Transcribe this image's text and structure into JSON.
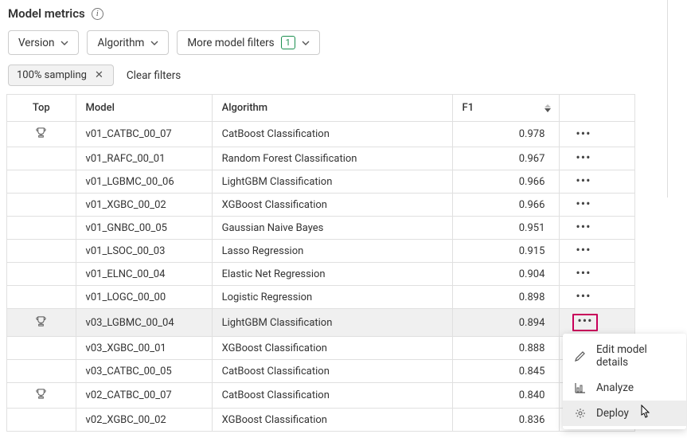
{
  "title": "Model metrics",
  "filters": {
    "version_label": "Version",
    "algorithm_label": "Algorithm",
    "more_label": "More model filters",
    "more_badge": "1"
  },
  "chip": {
    "label": "100% sampling"
  },
  "clear_filters": "Clear filters",
  "columns": {
    "top": "Top",
    "model": "Model",
    "algorithm": "Algorithm",
    "f1": "F1"
  },
  "rows": [
    {
      "top": true,
      "model": "v01_CATBC_00_07",
      "algorithm": "CatBoost Classification",
      "f1": "0.978"
    },
    {
      "top": false,
      "model": "v01_RAFC_00_01",
      "algorithm": "Random Forest Classification",
      "f1": "0.967"
    },
    {
      "top": false,
      "model": "v01_LGBMC_00_06",
      "algorithm": "LightGBM Classification",
      "f1": "0.966"
    },
    {
      "top": false,
      "model": "v01_XGBC_00_02",
      "algorithm": "XGBoost Classification",
      "f1": "0.966"
    },
    {
      "top": false,
      "model": "v01_GNBC_00_05",
      "algorithm": "Gaussian Naive Bayes",
      "f1": "0.951"
    },
    {
      "top": false,
      "model": "v01_LSOC_00_03",
      "algorithm": "Lasso Regression",
      "f1": "0.915"
    },
    {
      "top": false,
      "model": "v01_ELNC_00_04",
      "algorithm": "Elastic Net Regression",
      "f1": "0.904"
    },
    {
      "top": false,
      "model": "v01_LOGC_00_00",
      "algorithm": "Logistic Regression",
      "f1": "0.898"
    },
    {
      "top": true,
      "model": "v03_LGBMC_00_04",
      "algorithm": "LightGBM Classification",
      "f1": "0.894",
      "highlighted": true,
      "actions_outlined": true
    },
    {
      "top": false,
      "model": "v03_XGBC_00_01",
      "algorithm": "XGBoost Classification",
      "f1": "0.888",
      "no_actions": true
    },
    {
      "top": false,
      "model": "v03_CATBC_00_05",
      "algorithm": "CatBoost Classification",
      "f1": "0.845",
      "no_actions": true
    },
    {
      "top": true,
      "model": "v02_CATBC_00_07",
      "algorithm": "CatBoost Classification",
      "f1": "0.840",
      "no_actions": true
    },
    {
      "top": false,
      "model": "v02_XGBC_00_02",
      "algorithm": "XGBoost Classification",
      "f1": "0.836",
      "no_actions": true
    }
  ],
  "menu": {
    "edit": "Edit model details",
    "analyze": "Analyze",
    "deploy": "Deploy"
  }
}
